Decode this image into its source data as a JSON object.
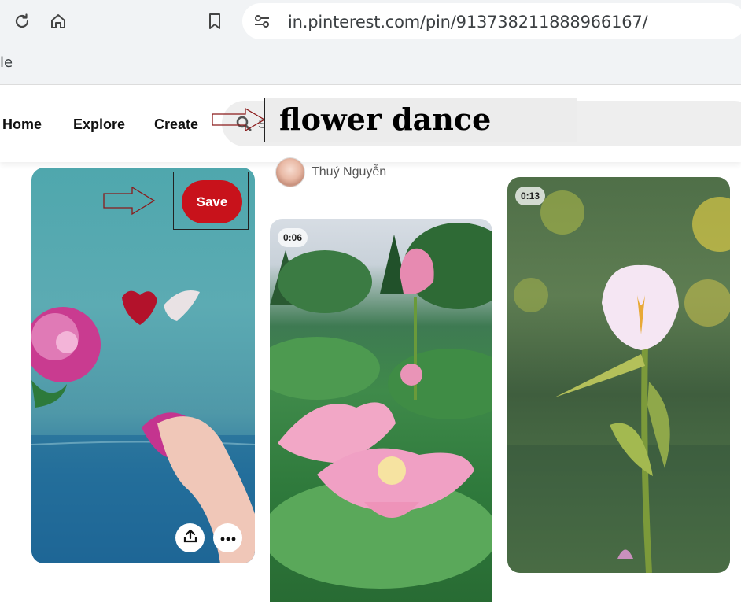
{
  "browser": {
    "url": "in.pinterest.com/pin/913738211888966167/",
    "bookmark_fragment": "le"
  },
  "header": {
    "nav": [
      "Home",
      "Explore",
      "Create"
    ],
    "search_placeholder": "Sear"
  },
  "annotation": {
    "callout_text": "flower dance"
  },
  "pins": [
    {
      "save_label": "Save",
      "share_icon": "share-icon",
      "more_icon": "more-icon"
    },
    {
      "author_name": "Thuý Nguyễn",
      "duration": "0:06"
    },
    {
      "duration": "0:13"
    }
  ],
  "colors": {
    "save_red": "#c8121b",
    "browser_chrome": "#f1f3f5",
    "search_bg": "#eeeeee"
  }
}
